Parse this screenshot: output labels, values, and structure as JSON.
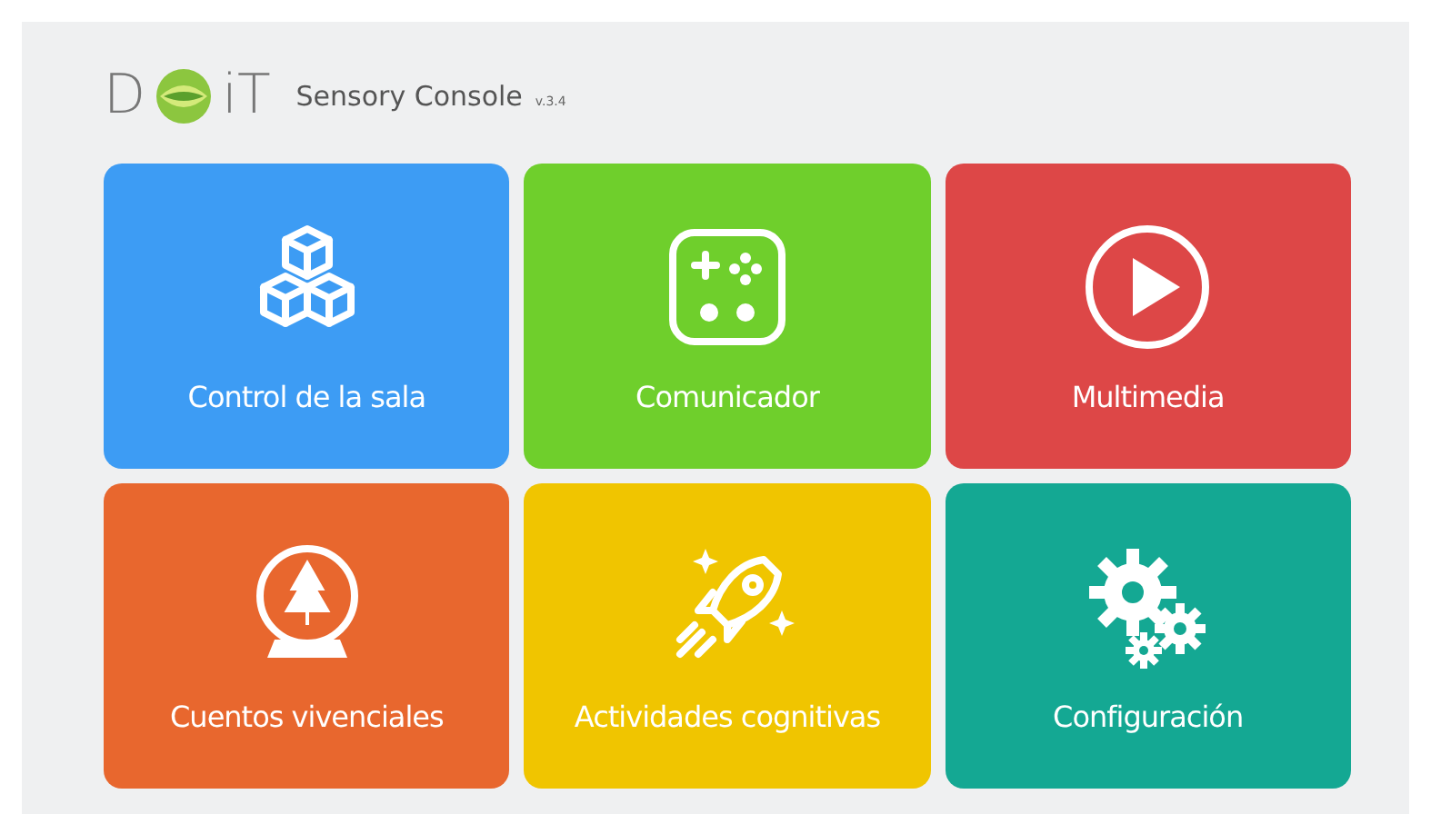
{
  "header": {
    "logo_start": "D",
    "logo_end": "iT",
    "title": "Sensory Console",
    "version": "v.3.4"
  },
  "tiles": [
    {
      "label": "Control de la sala",
      "kind": "cubes",
      "color": "#3d9cf4"
    },
    {
      "label": "Comunicador",
      "kind": "gamepad",
      "color": "#6fcf2c"
    },
    {
      "label": "Multimedia",
      "kind": "play",
      "color": "#dd4747"
    },
    {
      "label": "Cuentos vivenciales",
      "kind": "snowglobe",
      "color": "#e8672e"
    },
    {
      "label": "Actividades cognitivas",
      "kind": "rocket",
      "color": "#f0c500"
    },
    {
      "label": "Configuración",
      "kind": "gears",
      "color": "#14a893"
    }
  ]
}
